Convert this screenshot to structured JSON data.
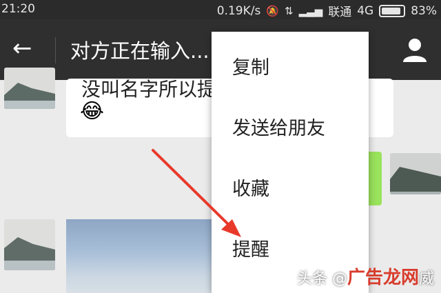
{
  "status_bar": {
    "time": "21:20",
    "network_speed": "0.19K/s",
    "carrier": "联通",
    "network_type": "4G",
    "battery": "83%",
    "battery_level": 0.83
  },
  "header": {
    "title": "对方正在输入..."
  },
  "chat": {
    "received_text": "没叫名字所以提",
    "received_emoji": "😂"
  },
  "context_menu": {
    "items": [
      "复制",
      "发送给朋友",
      "收藏",
      "提醒"
    ]
  },
  "watermark": {
    "text_left": "头条 @",
    "brand": "广告龙网",
    "text_right": "威"
  },
  "colors": {
    "title_bar": "#2f2f2f",
    "status_bar": "#2b2b2b",
    "chat_bg": "#ebebeb",
    "sent_bubble": "#9ae35c",
    "annotation_arrow": "#e8392b"
  }
}
